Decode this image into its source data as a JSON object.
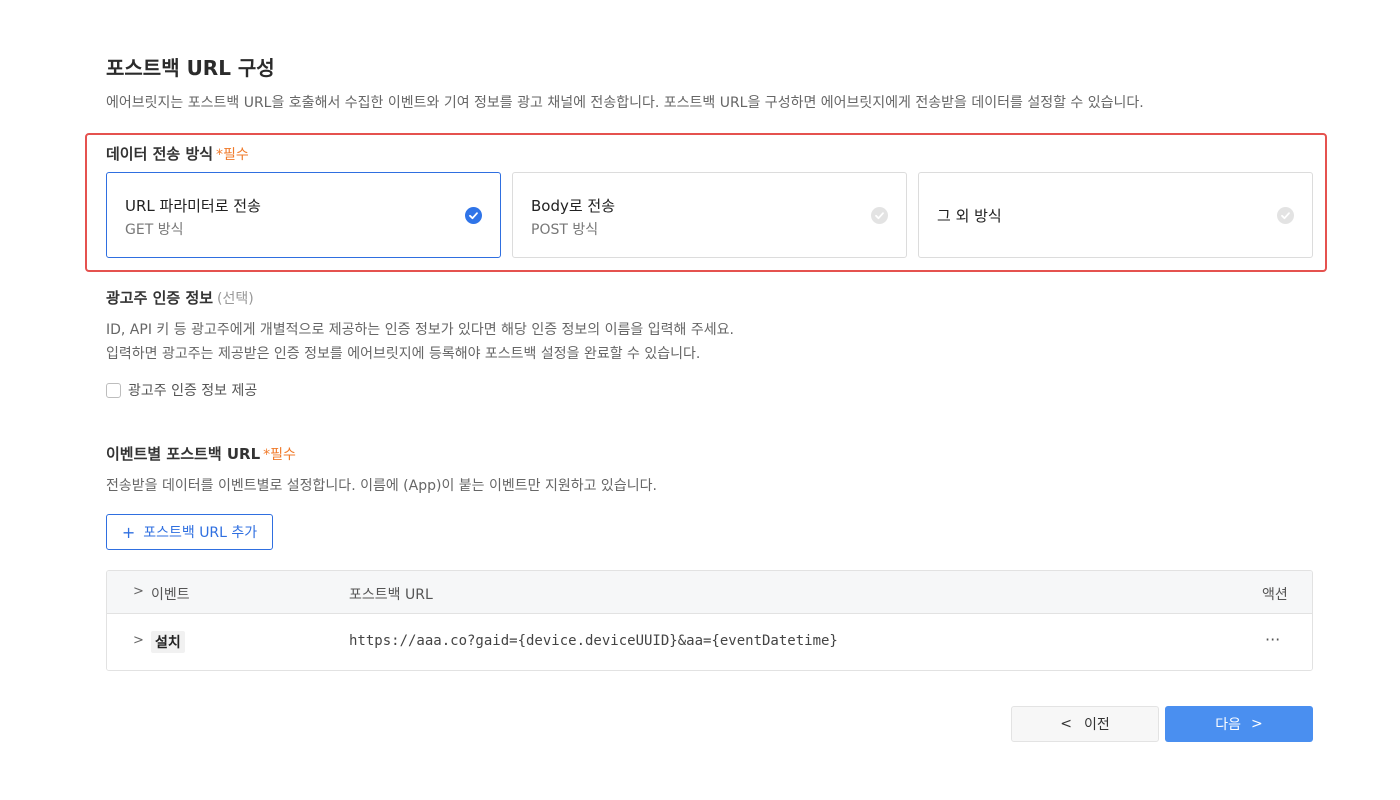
{
  "page": {
    "title": "포스트백 URL 구성",
    "description": "에어브릿지는 포스트백 URL을 호출해서 수집한 이벤트와 기여 정보를 광고 채널에 전송합니다. 포스트백 URL을 구성하면 에어브릿지에게 전송받을 데이터를 설정할 수 있습니다."
  },
  "transfer_method": {
    "label": "데이터 전송 방식",
    "required": "*필수",
    "options": [
      {
        "title": "URL 파라미터로 전송",
        "subtitle": "GET 방식",
        "selected": true
      },
      {
        "title": "Body로 전송",
        "subtitle": "POST 방식",
        "selected": false
      },
      {
        "title": "그 외 방식",
        "subtitle": "",
        "selected": false
      }
    ]
  },
  "advertiser_auth": {
    "label": "광고주 인증 정보",
    "optional": "(선택)",
    "desc_line1": "ID, API 키 등 광고주에게 개별적으로 제공하는 인증 정보가 있다면 해당 인증 정보의 이름을 입력해 주세요.",
    "desc_line2": "입력하면 광고주는 제공받은 인증 정보를 에어브릿지에 등록해야 포스트백 설정을 완료할 수 있습니다.",
    "checkbox_label": "광고주 인증 정보 제공",
    "checkbox_checked": false
  },
  "event_postback": {
    "label": "이벤트별 포스트백 URL",
    "required": "*필수",
    "description": "전송받을 데이터를 이벤트별로 설정합니다. 이름에 (App)이 붙는 이벤트만 지원하고 있습니다.",
    "add_button": "포스트백 URL 추가",
    "table": {
      "headers": {
        "event": "이벤트",
        "url": "포스트백 URL",
        "action": "액션"
      },
      "rows": [
        {
          "event": "설치",
          "url": "https://aaa.co?gaid={device.deviceUUID}&aa={eventDatetime}",
          "action": "···"
        }
      ]
    }
  },
  "footer": {
    "prev_label": "이전",
    "next_label": "다음"
  },
  "colors": {
    "accent": "#2f6fe0",
    "required": "#f07a2a",
    "highlight_border": "#e5524f",
    "next_button": "#4a8ff0"
  }
}
